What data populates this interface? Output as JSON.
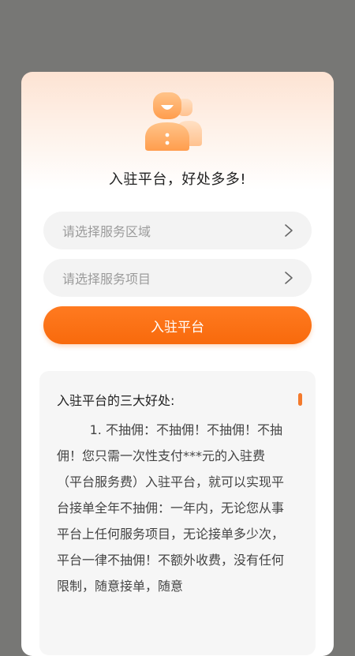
{
  "dialog": {
    "title": "入驻平台，好处多多!",
    "service_area_placeholder": "请选择服务区域",
    "service_item_placeholder": "请选择服务项目",
    "submit_label": "入驻平台"
  },
  "benefits": {
    "heading": "入驻平台的三大好处:",
    "body": "1. 不抽佣：不抽佣！不抽佣！不抽佣！您只需一次性支付***元的入驻费（平台服务费）入驻平台，就可以实现平台接单全年不抽佣：一年内，无论您从事平台上任何服务项目，无论接单多少次，平台一律不抽佣！不额外收费，没有任何限制，随意接单，随意"
  },
  "colors": {
    "accent": "#f86a0c",
    "overlay": "#777775"
  },
  "icons": {
    "avatar": "worker-avatar-icon",
    "chevron": "chevron-right-icon"
  }
}
